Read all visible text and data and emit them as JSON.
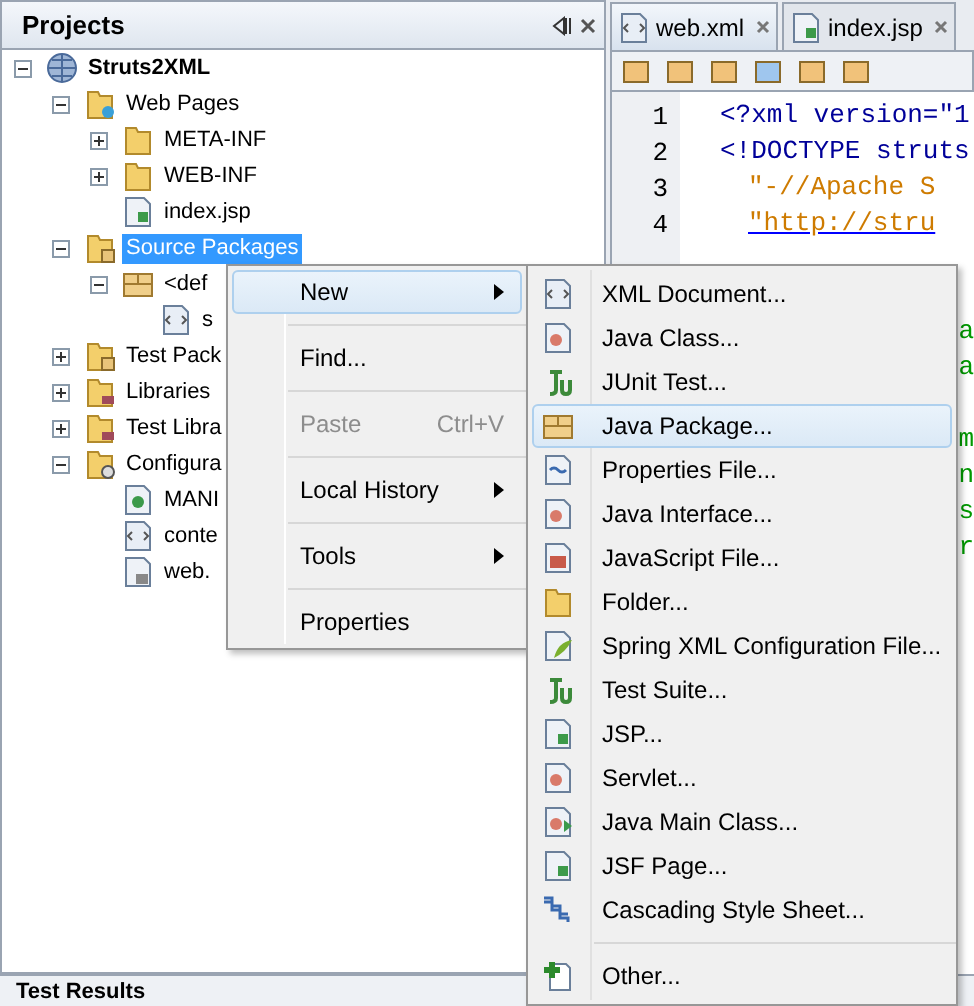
{
  "projects_panel": {
    "title": "Projects",
    "tree": [
      {
        "label": "Struts2XML",
        "kind": "project",
        "expanded": true,
        "selected": false,
        "children": [
          {
            "label": "Web Pages",
            "kind": "webfolder",
            "expanded": true,
            "selected": false,
            "children": [
              {
                "label": "META-INF",
                "kind": "folder",
                "expanded": false,
                "selected": false
              },
              {
                "label": "WEB-INF",
                "kind": "folder",
                "expanded": false,
                "selected": false
              },
              {
                "label": "index.jsp",
                "kind": "jsp",
                "selected": false
              }
            ]
          },
          {
            "label": "Source Packages",
            "kind": "pkgfolder",
            "expanded": true,
            "selected": true,
            "children": [
              {
                "label": "<def",
                "kind": "package",
                "expanded": true,
                "selected": false,
                "children": [
                  {
                    "label": "s",
                    "kind": "xml",
                    "selected": false
                  }
                ]
              }
            ]
          },
          {
            "label": "Test Pack",
            "kind": "pkgfolder",
            "expanded": false,
            "selected": false
          },
          {
            "label": "Libraries",
            "kind": "libfolder",
            "expanded": false,
            "selected": false
          },
          {
            "label": "Test Libra",
            "kind": "libfolder",
            "expanded": false,
            "selected": false
          },
          {
            "label": "Configura",
            "kind": "conffolder",
            "expanded": true,
            "selected": false,
            "children": [
              {
                "label": "MANI",
                "kind": "manifest",
                "selected": false
              },
              {
                "label": "conte",
                "kind": "xml",
                "selected": false
              },
              {
                "label": "web.",
                "kind": "webxml",
                "selected": false
              }
            ]
          }
        ]
      }
    ]
  },
  "editor": {
    "tabs": [
      {
        "label": "web.xml",
        "kind": "xml",
        "selected": true
      },
      {
        "label": "index.jsp",
        "kind": "jsp",
        "selected": false
      }
    ],
    "lines": [
      {
        "number": "1",
        "kind": "tag",
        "text": "<?xml version=\"1"
      },
      {
        "number": "2",
        "kind": "tag",
        "text": "<!DOCTYPE struts"
      },
      {
        "number": "3",
        "kind": "string",
        "text": "\"-//Apache S"
      },
      {
        "number": "4",
        "kind": "link",
        "text": "\"http://stru"
      },
      {
        "kind": "tail"
      },
      {
        "kind": "tail"
      },
      {
        "kind": "tail",
        "text": "a"
      },
      {
        "kind": "tail",
        "text": "a"
      },
      {
        "kind": "tail"
      },
      {
        "kind": "tail",
        "text": "m"
      },
      {
        "kind": "tail",
        "text": "n"
      },
      {
        "kind": "tail",
        "text": "s"
      },
      {
        "kind": "tail",
        "text": "r"
      }
    ]
  },
  "context_menu": {
    "items": [
      {
        "label": "New",
        "submenu": true,
        "disabled": false,
        "selected": true
      },
      {
        "label": "Find...",
        "submenu": false,
        "disabled": false,
        "selected": false
      },
      {
        "label": "Paste",
        "shortcut": "Ctrl+V",
        "submenu": false,
        "disabled": true,
        "selected": false
      },
      {
        "label": "Local History",
        "submenu": true,
        "disabled": false,
        "selected": false
      },
      {
        "label": "Tools",
        "submenu": true,
        "disabled": false,
        "selected": false
      },
      {
        "label": "Properties",
        "submenu": false,
        "disabled": false,
        "selected": false
      }
    ]
  },
  "new_submenu": {
    "groups": [
      {
        "items": [
          {
            "label": "XML Document...",
            "kind": "xml",
            "selected": false
          },
          {
            "label": "Java Class...",
            "kind": "class",
            "selected": false
          },
          {
            "label": "JUnit Test...",
            "kind": "junit",
            "selected": false
          },
          {
            "label": "Java Package...",
            "kind": "package",
            "selected": true
          },
          {
            "label": "Properties File...",
            "kind": "props",
            "selected": false
          },
          {
            "label": "Java Interface...",
            "kind": "class",
            "selected": false
          },
          {
            "label": "JavaScript File...",
            "kind": "js",
            "selected": false
          },
          {
            "label": "Folder...",
            "kind": "folder",
            "selected": false
          },
          {
            "label": "Spring XML Configuration File...",
            "kind": "spring",
            "selected": false
          },
          {
            "label": "Test Suite...",
            "kind": "junit",
            "selected": false
          },
          {
            "label": "JSP...",
            "kind": "jsp",
            "selected": false
          },
          {
            "label": "Servlet...",
            "kind": "class",
            "selected": false
          },
          {
            "label": "Java Main Class...",
            "kind": "main",
            "selected": false
          },
          {
            "label": "JSF Page...",
            "kind": "jsp",
            "selected": false
          },
          {
            "label": "Cascading Style Sheet...",
            "kind": "css",
            "selected": false
          }
        ]
      },
      {
        "items": [
          {
            "label": "Other...",
            "kind": "other",
            "selected": false
          }
        ]
      }
    ]
  },
  "bottom_panel": {
    "title": "Test Results"
  }
}
